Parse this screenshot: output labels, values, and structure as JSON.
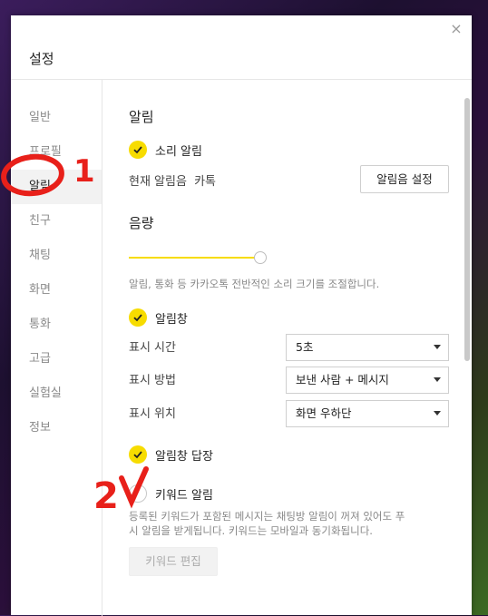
{
  "dialog": {
    "title": "설정",
    "close_icon": "×"
  },
  "sidebar": {
    "items": [
      {
        "label": "일반",
        "active": false
      },
      {
        "label": "프로필",
        "active": false
      },
      {
        "label": "알림",
        "active": true
      },
      {
        "label": "친구",
        "active": false
      },
      {
        "label": "채팅",
        "active": false
      },
      {
        "label": "화면",
        "active": false
      },
      {
        "label": "통화",
        "active": false
      },
      {
        "label": "고급",
        "active": false
      },
      {
        "label": "실험실",
        "active": false
      },
      {
        "label": "정보",
        "active": false
      }
    ]
  },
  "alarm": {
    "title": "알림",
    "sound_label": "소리 알림",
    "sound_checked": true,
    "current_sound_label": "현재 알림음",
    "current_sound_value": "카톡",
    "sound_settings_button": "알림음 설정"
  },
  "volume": {
    "title": "음량",
    "level": 1.0,
    "description": "알림, 통화 등 카카오톡 전반적인 소리 크기를 조절합니다."
  },
  "popup": {
    "label": "알림창",
    "checked": true,
    "display_time_label": "표시 시간",
    "display_time_value": "5초",
    "display_method_label": "표시 방법",
    "display_method_value": "보낸 사람 + 메시지",
    "display_position_label": "표시 위치",
    "display_position_value": "화면 우하단",
    "reply_label": "알림창 답장",
    "reply_checked": true
  },
  "keyword": {
    "label": "키워드 알림",
    "checked": false,
    "description_line1": "등록된 키워드가 포함된 메시지는 채팅방 알림이 꺼져 있어도 푸",
    "description_line2": "시 알림을 받게됩니다. 키워드는 모바일과 동기화됩니다.",
    "edit_button": "키워드 편집"
  },
  "annotations": {
    "mark1": "1",
    "mark2": "2"
  },
  "colors": {
    "accent": "#f7dc00",
    "annotation": "#e8201a"
  }
}
